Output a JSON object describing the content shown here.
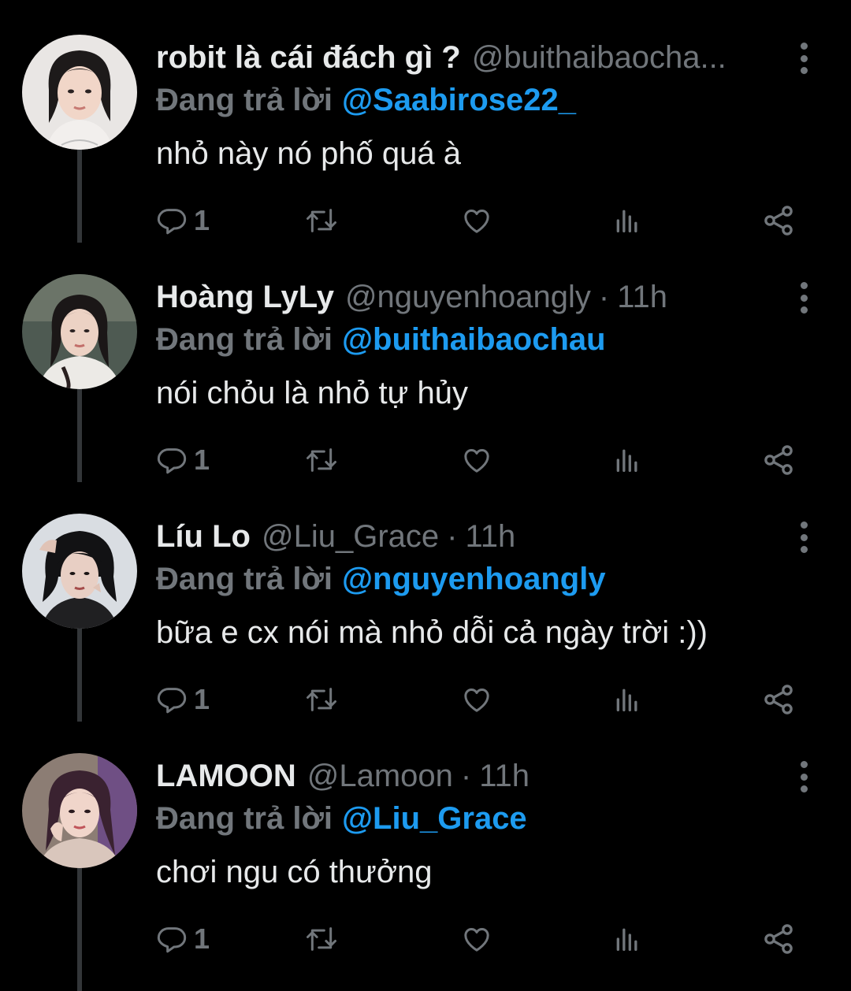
{
  "colors": {
    "background": "#000000",
    "primary_text": "#e7e9ea",
    "secondary_text": "#71767b",
    "accent": "#1d9bf0",
    "thread_line": "#333639"
  },
  "reply_prefix": "Đang trả lời",
  "tweets": [
    {
      "display_name": "robit là cái đách gì ?",
      "handle": "@buithaibaocha...",
      "time": "",
      "reply_to": "@Saabirose22_",
      "text": "nhỏ này nó phố quá à",
      "reply_count": "1",
      "avatar_icon": "user-avatar-photo"
    },
    {
      "display_name": "Hoàng LyLy",
      "handle": "@nguyenhoangly",
      "time": "11h",
      "reply_to": "@buithaibaochau",
      "text": "nói chỏu là nhỏ tự hủy",
      "reply_count": "1",
      "avatar_icon": "user-avatar-photo"
    },
    {
      "display_name": "Líu Lo",
      "handle": "@Liu_Grace",
      "time": "11h",
      "reply_to": "@nguyenhoangly",
      "text": "bữa e cx nói mà nhỏ dỗi cả ngày trời :))",
      "reply_count": "1",
      "avatar_icon": "user-avatar-photo"
    },
    {
      "display_name": "LAMOON",
      "handle": "@Lamoon",
      "time": "11h",
      "reply_to": "@Liu_Grace",
      "text": "chơi ngu có thưởng",
      "reply_count": "1",
      "avatar_icon": "user-avatar-photo"
    }
  ],
  "action_icons": [
    "reply-icon",
    "retweet-icon",
    "like-icon",
    "views-icon",
    "share-icon"
  ],
  "more_icon": "more-options-icon"
}
